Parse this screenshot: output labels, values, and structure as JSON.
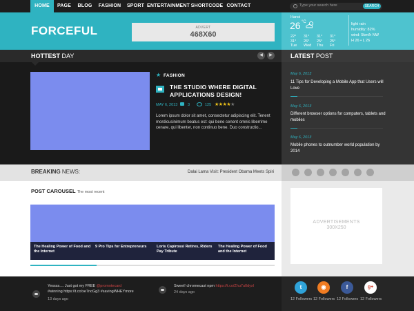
{
  "nav": {
    "items": [
      "HOME",
      "PAGE",
      "BLOG",
      "FASHION",
      "SPORT",
      "ENTERTAINMENT",
      "SHORTCODE",
      "CONTACT"
    ],
    "active": "HOME"
  },
  "search": {
    "placeholder": "Type your search here",
    "button": "SEARCH"
  },
  "header": {
    "logo": "FORCEFUL",
    "advert_label": "ADVERT",
    "advert_size": "468X60"
  },
  "weather": {
    "city": "Hanoi",
    "temp": "26",
    "unit": "°C",
    "condition": "light rain",
    "humidity": "humidity: 82%",
    "wind": "wind: 5km/h NW",
    "hl": "H 26 • L 26",
    "forecast": [
      {
        "temp": "22°",
        "temp2": "31°",
        "day": "Tue"
      },
      {
        "temp": "31°",
        "temp2": "26°",
        "day": "Wed"
      },
      {
        "temp": "31°",
        "temp2": "25°",
        "day": "Thu"
      },
      {
        "temp": "31°",
        "temp2": "25°",
        "day": "Fri"
      }
    ]
  },
  "hottest": {
    "title_bold": "HOTTEST",
    "title_rest": " DAY",
    "category": "FASHION",
    "post_title": "THE STUDIO WHERE DIGITAL APPLICATIONS DESIGN!",
    "date": "MAY 6, 2013",
    "comments": "3",
    "views": "125",
    "rating": 4,
    "rating_max": 5,
    "excerpt": "Lorem ipsum dolor sit amet, consectetur adipiscing elit. Tenent mordicusinimum beatus est: qui bene cenent omnis liberrime cenare, qui libenter, non continuo bene. Duo constructio..."
  },
  "latest": {
    "title_bold": "LATEST",
    "title_rest": " POST",
    "items": [
      {
        "date": "May 6, 2013",
        "text": "11 Tips for Developing a Mobile App that Users will Love"
      },
      {
        "date": "May 6, 2013",
        "text": "Different browser options for computers, tablets and mobiles"
      },
      {
        "date": "May 6, 2013",
        "text": "Mobile phones to outnumber world population by 2014"
      }
    ]
  },
  "breaking": {
    "label_bold": "BREAKING",
    "label_rest": " NEWS:",
    "text": "Dalai Lama Visit: President Obama Meets Spiri"
  },
  "social_strip": [
    "dr",
    "g+",
    "f",
    "t",
    "rss",
    "fl",
    "v"
  ],
  "carousel": {
    "title_bold": "POST CAROUSEL",
    "subtitle": "The most recent",
    "captions": [
      "The Healing Power of Food and the Internet",
      "9 Pro Tips for Entrepreneurs",
      "Loris Capirossi Retires, Riders Pay Tribute",
      "The Healing Power of Food and the Internet"
    ],
    "progress": 0.27
  },
  "ad300": {
    "label": "ADVERTISEMENTS",
    "size": "300X250"
  },
  "footer": {
    "tweets": [
      {
        "text_a": "Yessss.... Just got my FREE ",
        "link": "@promotecard",
        "text_b": " #winning https://t.co/xe7ncGg3 #savingWHEYmore",
        "date": "13 days ago"
      },
      {
        "text_a": "Sweet! chromecast npm ",
        "link": "https://t.co/Zhu7u0dyxl",
        "text_b": "",
        "date": "24 days ago"
      }
    ],
    "social": [
      {
        "icon": "t",
        "color": "#2fa3d9",
        "followers": "12 Followers"
      },
      {
        "icon": "rss",
        "color": "#f07c22",
        "followers": "12 Followers"
      },
      {
        "icon": "f",
        "color": "#3b5998",
        "followers": "12 Followers"
      },
      {
        "icon": "g+",
        "color": "#ffffff",
        "followers": "12 Followers"
      }
    ]
  }
}
